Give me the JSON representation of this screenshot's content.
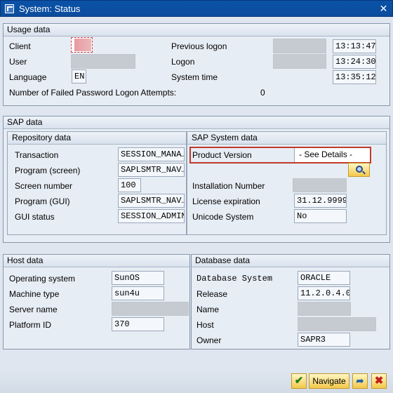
{
  "window": {
    "title": "System: Status",
    "close_glyph": "✕"
  },
  "usage": {
    "title": "Usage data",
    "client_label": "Client",
    "user_label": "User",
    "language_label": "Language",
    "language_value": "EN",
    "previous_logon_label": "Previous logon",
    "previous_logon_time": "13:13:47",
    "logon_label": "Logon",
    "logon_time": "13:24:30",
    "system_time_label": "System time",
    "system_time": "13:35:12",
    "failed_attempts_label": "Number of Failed Password Logon Attempts:",
    "failed_attempts_value": "0"
  },
  "sap": {
    "title": "SAP data",
    "repository": {
      "title": "Repository data",
      "transaction_label": "Transaction",
      "transaction_value": "SESSION_MANA…",
      "program_screen_label": "Program (screen)",
      "program_screen_value": "SAPLSMTR_NAV…",
      "screen_number_label": "Screen number",
      "screen_number_value": "100",
      "program_gui_label": "Program (GUI)",
      "program_gui_value": "SAPLSMTR_NAV…",
      "gui_status_label": "GUI status",
      "gui_status_value": "SESSION_ADMIN"
    },
    "system": {
      "title": "SAP System data",
      "product_version_label": "Product Version",
      "product_version_value": "- See Details -",
      "installation_number_label": "Installation Number",
      "license_expiration_label": "License expiration",
      "license_expiration_value": "31.12.9999",
      "unicode_label": "Unicode System",
      "unicode_value": "No"
    }
  },
  "host": {
    "title": "Host data",
    "os_label": "Operating system",
    "os_value": "SunOS",
    "machine_label": "Machine type",
    "machine_value": "sun4u",
    "server_label": "Server name",
    "platform_label": "Platform ID",
    "platform_value": "370"
  },
  "database": {
    "title": "Database data",
    "system_label": "Database System",
    "system_value": "ORACLE",
    "release_label": "Release",
    "release_value": "11.2.0.4.0",
    "name_label": "Name",
    "host_label": "Host",
    "owner_label": "Owner",
    "owner_value": "SAPR3"
  },
  "footer": {
    "ok_glyph": "✔",
    "navigate_label": "Navigate",
    "other_glyph": "➦",
    "cancel_glyph": "✖"
  },
  "icons": {
    "window": "window-icon",
    "details": "magnifier-icon",
    "ok": "check-icon",
    "other": "arrow-icon",
    "cancel": "cancel-icon"
  }
}
